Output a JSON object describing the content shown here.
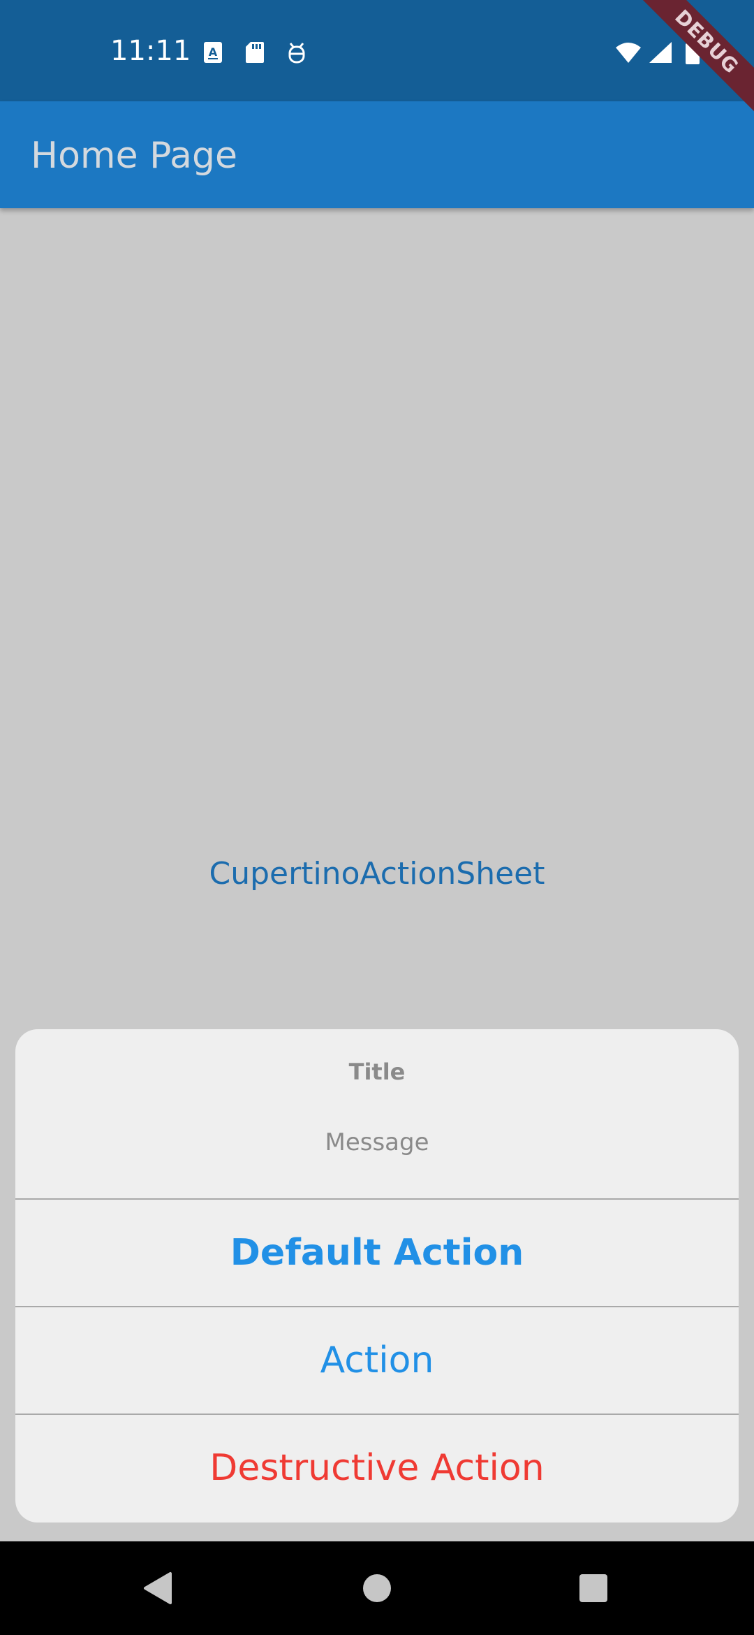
{
  "status_bar": {
    "time": "11:11",
    "left_icons": [
      "a-letter-icon",
      "sd-card-icon",
      "bug-icon"
    ],
    "right_icons": [
      "wifi-icon",
      "signal-icon",
      "battery-icon"
    ]
  },
  "debug_banner": "DEBUG",
  "app_bar": {
    "title": "Home Page"
  },
  "body": {
    "link_text": "CupertinoActionSheet"
  },
  "action_sheet": {
    "title": "Title",
    "message": "Message",
    "actions": [
      {
        "label": "Default Action",
        "type": "default"
      },
      {
        "label": "Action",
        "type": "normal"
      },
      {
        "label": "Destructive Action",
        "type": "destructive"
      }
    ]
  },
  "nav_bar": {
    "buttons": [
      "back-icon",
      "home-icon",
      "recents-icon"
    ]
  },
  "colors": {
    "status_bar": "#145e96",
    "app_bar": "#1c78c2",
    "action_blue": "#2190e6",
    "destructive_red": "#ef3a33",
    "scrim": "#c9c9c9"
  }
}
